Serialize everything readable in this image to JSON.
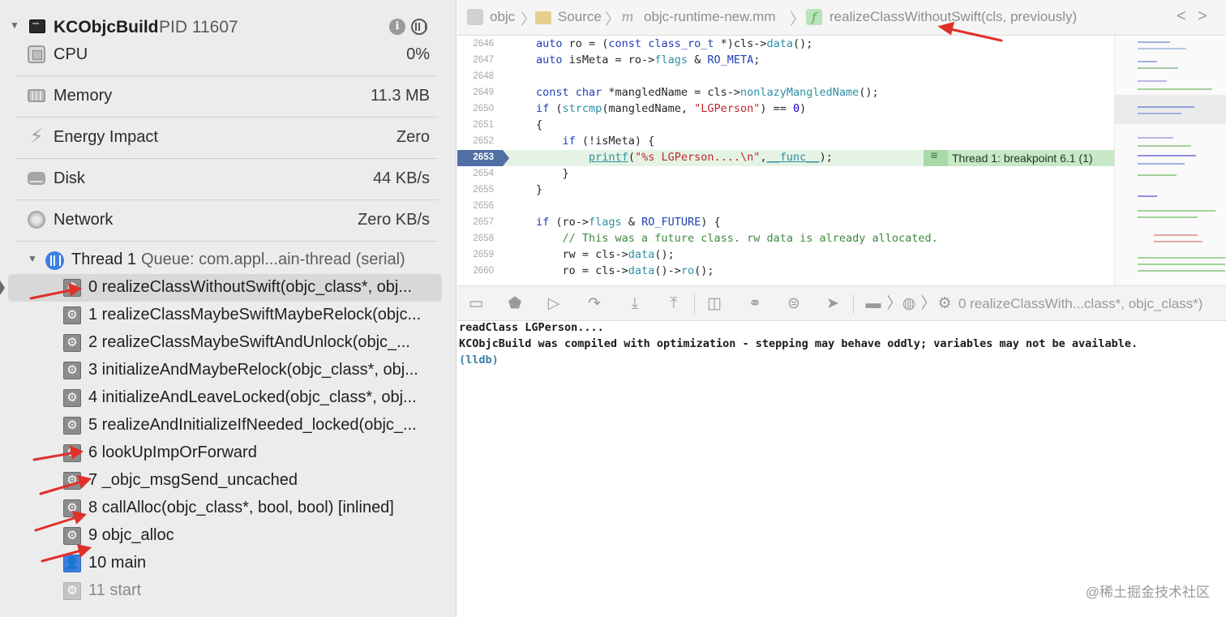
{
  "process": {
    "name": "KCObjcBuild",
    "pid": "PID 11607",
    "info_icon": "i"
  },
  "gauges": [
    {
      "label": "CPU",
      "value": "0%",
      "icon": "cpu-icon"
    },
    {
      "label": "Memory",
      "value": "11.3 MB",
      "icon": "memory-icon"
    },
    {
      "label": "Energy Impact",
      "value": "Zero",
      "icon": "energy-icon"
    },
    {
      "label": "Disk",
      "value": "44 KB/s",
      "icon": "disk-icon"
    },
    {
      "label": "Network",
      "value": "Zero KB/s",
      "icon": "network-icon"
    }
  ],
  "thread": {
    "title": "Thread 1",
    "queue": "Queue: com.appl...ain-thread (serial)"
  },
  "frames": [
    {
      "label": "0 realizeClassWithoutSwift(objc_class*, obj...",
      "kind": "system",
      "selected": true
    },
    {
      "label": "1 realizeClassMaybeSwiftMaybeRelock(objc...",
      "kind": "system"
    },
    {
      "label": "2 realizeClassMaybeSwiftAndUnlock(objc_...",
      "kind": "system"
    },
    {
      "label": "3 initializeAndMaybeRelock(objc_class*, obj...",
      "kind": "system"
    },
    {
      "label": "4 initializeAndLeaveLocked(objc_class*, obj...",
      "kind": "system"
    },
    {
      "label": "5 realizeAndInitializeIfNeeded_locked(objc_...",
      "kind": "system"
    },
    {
      "label": "6 lookUpImpOrForward",
      "kind": "system"
    },
    {
      "label": "7 _objc_msgSend_uncached",
      "kind": "system"
    },
    {
      "label": "8 callAlloc(objc_class*, bool, bool) [inlined]",
      "kind": "system"
    },
    {
      "label": "9 objc_alloc",
      "kind": "system"
    },
    {
      "label": "10 main",
      "kind": "user"
    },
    {
      "label": "11 start",
      "kind": "faded"
    }
  ],
  "jumpbar": {
    "crumbs": [
      "objc",
      "Source",
      "objc-runtime-new.mm",
      "realizeClassWithoutSwift(cls, previously)"
    ],
    "file_icon_letter": "m",
    "func_icon_letter": "f",
    "back": "<",
    "forward": ">"
  },
  "editor": {
    "current_line": "2653",
    "badge": "Thread 1: breakpoint 6.1 (1)",
    "lines": [
      {
        "n": "2646",
        "t": "auto ro = (const class_ro_t *)cls->data();"
      },
      {
        "n": "2647",
        "t": "auto isMeta = ro->flags & RO_META;"
      },
      {
        "n": "2648",
        "t": ""
      },
      {
        "n": "2649",
        "t": "const char *mangledName = cls->nonlazyMangledName();"
      },
      {
        "n": "2650",
        "t": "if (strcmp(mangledName, \"LGPerson\") == 0)"
      },
      {
        "n": "2651",
        "t": "{"
      },
      {
        "n": "2652",
        "t": "    if (!isMeta) {"
      },
      {
        "n": "2653",
        "t": "        printf(\"%s LGPerson....\\n\",__func__);"
      },
      {
        "n": "2654",
        "t": "    }"
      },
      {
        "n": "2655",
        "t": "}"
      },
      {
        "n": "2656",
        "t": ""
      },
      {
        "n": "2657",
        "t": "if (ro->flags & RO_FUTURE) {"
      },
      {
        "n": "2658",
        "t": "    // This was a future class. rw data is already allocated."
      },
      {
        "n": "2659",
        "t": "    rw = cls->data();"
      },
      {
        "n": "2660",
        "t": "    ro = cls->data()->ro();"
      }
    ]
  },
  "debugbar": {
    "frame_text": "0 realizeClassWith...class*, objc_class*)"
  },
  "console": {
    "lines": [
      "readClass LGPerson....",
      "KCObjcBuild was compiled with optimization - stepping may behave oddly; variables may not be available.",
      "(lldb)"
    ]
  },
  "watermark": "@稀土掘金技术社区",
  "colors": {
    "accent": "#3e7ee6",
    "current_line_bg": "#e4f3e4",
    "badge_bg": "#c8e8c8",
    "arrow": "#e0302a"
  }
}
